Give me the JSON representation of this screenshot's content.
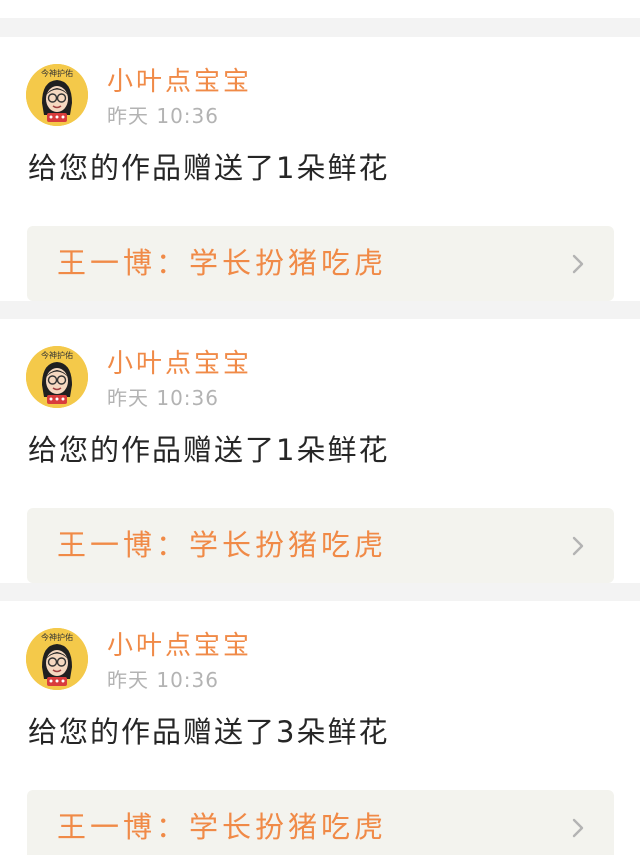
{
  "notifications": [
    {
      "username": "小叶点宝宝",
      "time": "昨天 10:36",
      "message": "给您的作品赠送了1朵鲜花",
      "work_title": "王一博：学长扮猪吃虎",
      "avatar_caption": "今神护佑"
    },
    {
      "username": "小叶点宝宝",
      "time": "昨天 10:36",
      "message": "给您的作品赠送了1朵鲜花",
      "work_title": "王一博：学长扮猪吃虎",
      "avatar_caption": "今神护佑"
    },
    {
      "username": "小叶点宝宝",
      "time": "昨天 10:36",
      "message": "给您的作品赠送了3朵鲜花",
      "work_title": "王一博：学长扮猪吃虎",
      "avatar_caption": "今神护佑"
    }
  ],
  "colors": {
    "accent": "#f08a47",
    "text": "#262626",
    "muted": "#b3b3b3",
    "link_background": "#f3f3ee",
    "page_background": "#f3f3f3"
  },
  "icons": {
    "avatar": "cartoon-avatar-icon",
    "chevron": "chevron-right-icon"
  }
}
